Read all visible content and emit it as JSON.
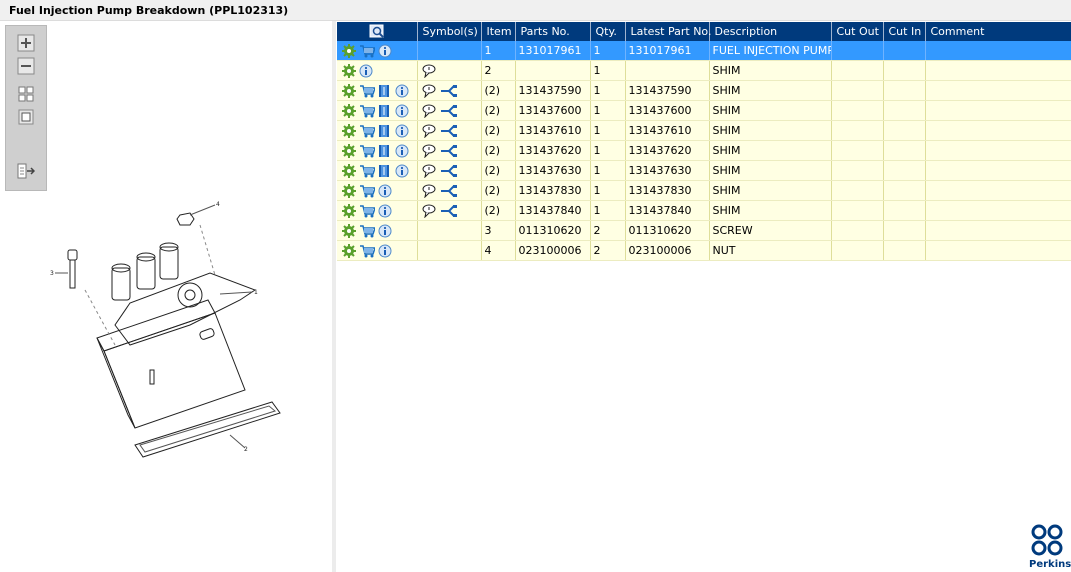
{
  "window": {
    "title": "Fuel Injection Pump Breakdown (PPL102313)"
  },
  "toolbar": {
    "buttons": [
      "zoom-in",
      "zoom-out",
      "fit-all",
      "fit-page",
      "export"
    ]
  },
  "diagram": {
    "callouts": [
      "1",
      "2",
      "3",
      "4"
    ]
  },
  "grid": {
    "columns": [
      "",
      "Symbol(s)",
      "Item",
      "Parts No.",
      "Qty.",
      "Latest Part No.",
      "Description",
      "Cut Out",
      "Cut In",
      "Comment"
    ],
    "rows": [
      {
        "item": "1",
        "part": "131017961",
        "qty": "1",
        "latest": "131017961",
        "desc": "FUEL INJECTION PUMP",
        "cutout": "",
        "cutin": "",
        "comment": "",
        "icons": "gear,cart,info",
        "symbols": "",
        "selected": true
      },
      {
        "item": "2",
        "part": "",
        "qty": "1",
        "latest": "",
        "desc": "SHIM",
        "cutout": "",
        "cutin": "",
        "comment": "",
        "icons": "gear,info",
        "symbols": "note",
        "selected": false
      },
      {
        "item": "(2)",
        "part": "131437590",
        "qty": "1",
        "latest": "131437590",
        "desc": "SHIM",
        "cutout": "",
        "cutin": "",
        "comment": "",
        "icons": "gear,cart,book,info",
        "symbols": "note,link",
        "selected": false
      },
      {
        "item": "(2)",
        "part": "131437600",
        "qty": "1",
        "latest": "131437600",
        "desc": "SHIM",
        "cutout": "",
        "cutin": "",
        "comment": "",
        "icons": "gear,cart,book,info",
        "symbols": "note,link",
        "selected": false
      },
      {
        "item": "(2)",
        "part": "131437610",
        "qty": "1",
        "latest": "131437610",
        "desc": "SHIM",
        "cutout": "",
        "cutin": "",
        "comment": "",
        "icons": "gear,cart,book,info",
        "symbols": "note,link",
        "selected": false
      },
      {
        "item": "(2)",
        "part": "131437620",
        "qty": "1",
        "latest": "131437620",
        "desc": "SHIM",
        "cutout": "",
        "cutin": "",
        "comment": "",
        "icons": "gear,cart,book,info",
        "symbols": "note,link",
        "selected": false
      },
      {
        "item": "(2)",
        "part": "131437630",
        "qty": "1",
        "latest": "131437630",
        "desc": "SHIM",
        "cutout": "",
        "cutin": "",
        "comment": "",
        "icons": "gear,cart,book,info",
        "symbols": "note,link",
        "selected": false
      },
      {
        "item": "(2)",
        "part": "131437830",
        "qty": "1",
        "latest": "131437830",
        "desc": "SHIM",
        "cutout": "",
        "cutin": "",
        "comment": "",
        "icons": "gear,cart,info",
        "symbols": "note,link",
        "selected": false
      },
      {
        "item": "(2)",
        "part": "131437840",
        "qty": "1",
        "latest": "131437840",
        "desc": "SHIM",
        "cutout": "",
        "cutin": "",
        "comment": "",
        "icons": "gear,cart,info",
        "symbols": "note,link",
        "selected": false
      },
      {
        "item": "3",
        "part": "011310620",
        "qty": "2",
        "latest": "011310620",
        "desc": "SCREW",
        "cutout": "",
        "cutin": "",
        "comment": "",
        "icons": "gear,cart,info",
        "symbols": "",
        "selected": false
      },
      {
        "item": "4",
        "part": "023100006",
        "qty": "2",
        "latest": "023100006",
        "desc": "NUT",
        "cutout": "",
        "cutin": "",
        "comment": "",
        "icons": "gear,cart,info",
        "symbols": "",
        "selected": false
      }
    ]
  },
  "logo": {
    "text": "Perkins"
  },
  "colors": {
    "header": "#003a7d",
    "selected": "#3399ff",
    "row": "#ffffe3",
    "brand": "#003a7d"
  }
}
